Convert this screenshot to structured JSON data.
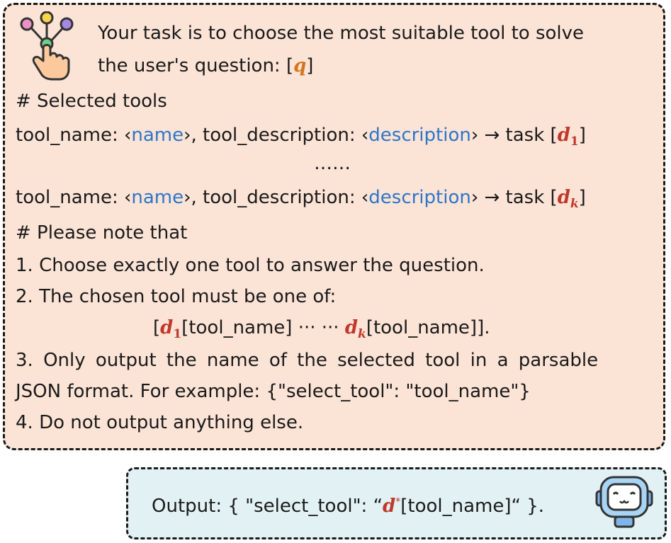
{
  "prompt": {
    "intro_line1": "Your task is to choose the most suitable tool to solve",
    "intro_line2_prefix": "the user's question: [",
    "q_var": "q",
    "intro_line2_suffix": "]",
    "selected_tools_heading": "# Selected tools",
    "tool_line": {
      "prefix": "tool_name: ‹",
      "name": "name",
      "mid": "›, tool_description: ‹",
      "description": "description",
      "arrow_task": "› → task [",
      "d_var": "d",
      "close": "]"
    },
    "sub_1": "1",
    "sub_k": "k",
    "ellipsis": "……",
    "note_heading": "# Please note that",
    "rule1": "1. Choose exactly one tool to answer the question.",
    "rule2": "2. The chosen tool must be one of:",
    "rule2_list": {
      "open": "[",
      "d_var": "d",
      "item_suffix": "[tool_name]",
      "dots": " ··· ··· ",
      "close": "]."
    },
    "rule3_line1": "3. Only output the name of the selected tool in a parsable",
    "rule3_line2": "JSON format. For example: {\"select_tool\": \"tool_name\"}",
    "rule4": "4. Do not output anything else."
  },
  "output": {
    "prefix": "Output: { \"select_tool\": “",
    "d_var": "d",
    "star": "*",
    "suffix": "[tool_name]“ }."
  },
  "icons": [
    "hand-tool-icon",
    "robot-icon"
  ],
  "colors": {
    "prompt_bg": "#fbe3d6",
    "output_bg": "#e2f1f4",
    "keyword_blue": "#2f76c8",
    "var_red": "#c0392b",
    "var_orange": "#d4761e"
  }
}
